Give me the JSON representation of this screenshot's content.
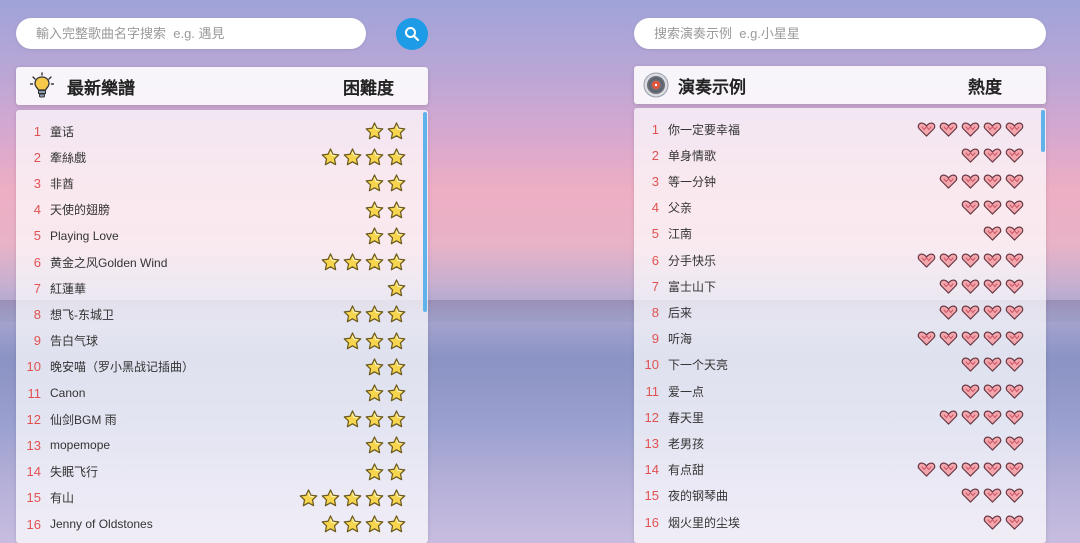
{
  "colors": {
    "accent": "#1e9be6",
    "rank": "#e05252"
  },
  "left": {
    "search_placeholder": "輸入完整歌曲名字搜索  e.g. 遇見",
    "title": "最新樂譜",
    "column": "困難度",
    "mark_icon": "star-icon",
    "items": [
      {
        "rank": "1",
        "name": "童话",
        "level": 2
      },
      {
        "rank": "2",
        "name": "牽絲戲",
        "level": 4
      },
      {
        "rank": "3",
        "name": "非酋",
        "level": 2
      },
      {
        "rank": "4",
        "name": "天使的翅膀",
        "level": 2
      },
      {
        "rank": "5",
        "name": "Playing Love",
        "level": 2
      },
      {
        "rank": "6",
        "name": "黄金之风Golden Wind",
        "level": 4
      },
      {
        "rank": "7",
        "name": "紅蓮華",
        "level": 1
      },
      {
        "rank": "8",
        "name": "想飞-东城卫",
        "level": 3
      },
      {
        "rank": "9",
        "name": "告白气球",
        "level": 3
      },
      {
        "rank": "10",
        "name": "晚安喵（罗小黑战记插曲）",
        "level": 2
      },
      {
        "rank": "11",
        "name": "Canon",
        "level": 2
      },
      {
        "rank": "12",
        "name": "仙剑BGM 雨",
        "level": 3
      },
      {
        "rank": "13",
        "name": "mopemope",
        "level": 2
      },
      {
        "rank": "14",
        "name": "失眠飞行",
        "level": 2
      },
      {
        "rank": "15",
        "name": "有山",
        "level": 5
      },
      {
        "rank": "16",
        "name": "Jenny of Oldstones",
        "level": 4
      }
    ]
  },
  "right": {
    "search_placeholder": "搜索演奏示例  e.g.小星星",
    "title": "演奏示例",
    "column": "熱度",
    "mark_icon": "heart-icon",
    "items": [
      {
        "rank": "1",
        "name": "你一定要幸福",
        "level": 5
      },
      {
        "rank": "2",
        "name": "单身情歌",
        "level": 3
      },
      {
        "rank": "3",
        "name": "等一分钟",
        "level": 4
      },
      {
        "rank": "4",
        "name": "父亲",
        "level": 3
      },
      {
        "rank": "5",
        "name": "江南",
        "level": 2
      },
      {
        "rank": "6",
        "name": "分手快乐",
        "level": 5
      },
      {
        "rank": "7",
        "name": "富士山下",
        "level": 4
      },
      {
        "rank": "8",
        "name": "后来",
        "level": 4
      },
      {
        "rank": "9",
        "name": "听海",
        "level": 5
      },
      {
        "rank": "10",
        "name": "下一个天亮",
        "level": 3
      },
      {
        "rank": "11",
        "name": "爱一点",
        "level": 3
      },
      {
        "rank": "12",
        "name": "春天里",
        "level": 4
      },
      {
        "rank": "13",
        "name": "老男孩",
        "level": 2
      },
      {
        "rank": "14",
        "name": "有点甜",
        "level": 5
      },
      {
        "rank": "15",
        "name": "夜的钢琴曲",
        "level": 3
      },
      {
        "rank": "16",
        "name": "烟火里的尘埃",
        "level": 2
      }
    ]
  }
}
